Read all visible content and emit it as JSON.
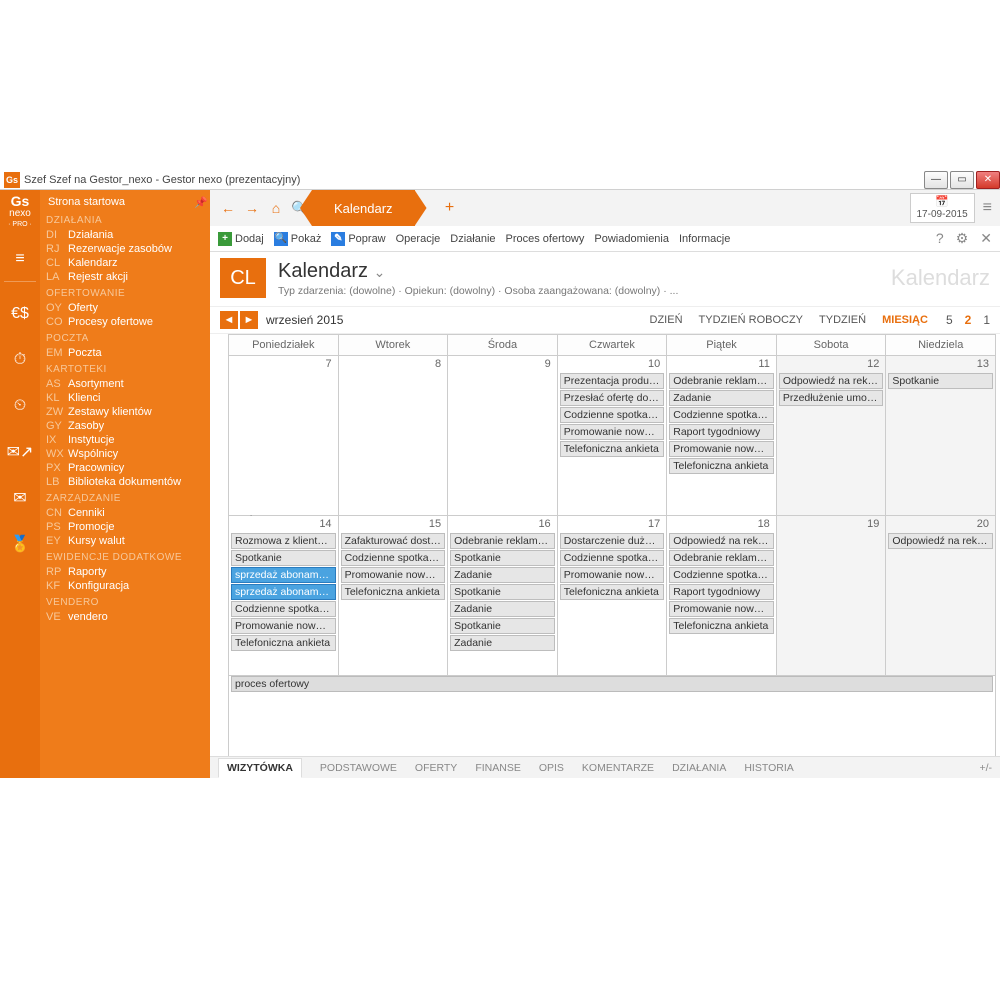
{
  "window": {
    "title": "Szef Szef na Gestor_nexo - Gestor nexo (prezentacyjny)",
    "app_icon_text": "Gs"
  },
  "logo": {
    "line1": "Gs",
    "line2": "nexo",
    "line3": "· PRO ·"
  },
  "date_widget": "17-09-2015",
  "sidenav": {
    "home": "Strona startowa",
    "groups": [
      {
        "title": "DZIAŁANIA",
        "items": [
          {
            "code": "DI",
            "label": "Działania"
          },
          {
            "code": "RJ",
            "label": "Rezerwacje zasobów"
          },
          {
            "code": "CL",
            "label": "Kalendarz"
          },
          {
            "code": "LA",
            "label": "Rejestr akcji"
          }
        ]
      },
      {
        "title": "OFERTOWANIE",
        "items": [
          {
            "code": "OY",
            "label": "Oferty"
          },
          {
            "code": "CO",
            "label": "Procesy ofertowe"
          }
        ]
      },
      {
        "title": "POCZTA",
        "items": [
          {
            "code": "EM",
            "label": "Poczta"
          }
        ]
      },
      {
        "title": "KARTOTEKI",
        "items": [
          {
            "code": "AS",
            "label": "Asortyment"
          },
          {
            "code": "KL",
            "label": "Klienci"
          },
          {
            "code": "ZW",
            "label": "Zestawy klientów"
          },
          {
            "code": "GY",
            "label": "Zasoby"
          },
          {
            "code": "IX",
            "label": "Instytucje"
          },
          {
            "code": "WX",
            "label": "Wspólnicy"
          },
          {
            "code": "PX",
            "label": "Pracownicy"
          },
          {
            "code": "LB",
            "label": "Biblioteka dokumentów"
          }
        ]
      },
      {
        "title": "ZARZĄDZANIE",
        "items": [
          {
            "code": "CN",
            "label": "Cenniki"
          },
          {
            "code": "PS",
            "label": "Promocje"
          },
          {
            "code": "EY",
            "label": "Kursy walut"
          }
        ]
      },
      {
        "title": "EWIDENCJE DODATKOWE",
        "items": [
          {
            "code": "RP",
            "label": "Raporty"
          },
          {
            "code": "KF",
            "label": "Konfiguracja"
          }
        ]
      },
      {
        "title": "VENDERO",
        "items": [
          {
            "code": "VE",
            "label": "vendero"
          }
        ]
      }
    ]
  },
  "tabs": {
    "active": "Kalendarz"
  },
  "toolbar": {
    "add": "Dodaj",
    "show": "Pokaż",
    "edit": "Popraw",
    "ops": "Operacje",
    "action": "Działanie",
    "offer": "Proces ofertowy",
    "notif": "Powiadomienia",
    "info": "Informacje"
  },
  "header": {
    "code": "CL",
    "title": "Kalendarz",
    "subtitle": "Typ zdarzenia: (dowolne) · Opiekun: (dowolny) · Osoba zaangażowana: (dowolny) · ...",
    "ghost": "Kalendarz"
  },
  "period": {
    "label": "wrzesień 2015",
    "vertical": "Wrzesień 2015",
    "modes": [
      "DZIEŃ",
      "TYDZIEŃ ROBOCZY",
      "TYDZIEŃ",
      "MIESIĄC"
    ],
    "mode_active": "MIESIĄC",
    "nums": [
      "5",
      "2",
      "1"
    ],
    "num_active": "2"
  },
  "calendar": {
    "day_headers": [
      "Poniedziałek",
      "Wtorek",
      "Środa",
      "Czwartek",
      "Piątek",
      "Sobota",
      "Niedziela"
    ],
    "weeks": [
      {
        "days": [
          {
            "num": 7,
            "events": []
          },
          {
            "num": 8,
            "events": []
          },
          {
            "num": 9,
            "events": []
          },
          {
            "num": 10,
            "events": [
              "Prezentacja produktó...",
              "Przesłać ofertę do fir...",
              "Codzienne spotkanie...",
              "Promowanie noweg...",
              "Telefoniczna ankieta"
            ]
          },
          {
            "num": 11,
            "events": [
              "Odebranie reklamacj...",
              "Zadanie",
              "Codzienne spotkanie...",
              "Raport tygodniowy",
              "Promowanie noweg...",
              "Telefoniczna ankieta"
            ]
          },
          {
            "num": 12,
            "weekend": true,
            "events": [
              "Odpowiedź na rekla...",
              "Przedłużenie umowy"
            ]
          },
          {
            "num": 13,
            "weekend": true,
            "events": [
              "Spotkanie"
            ]
          }
        ]
      },
      {
        "days": [
          {
            "num": 14,
            "events": [
              "Rozmowa z klientem...",
              "Spotkanie",
              {
                "t": "sprzedaż abonamentu",
                "c": "blue"
              },
              {
                "t": "sprzedaż abonamentu",
                "c": "blue"
              },
              "Codzienne spotkanie...",
              "Promowanie noweg...",
              "Telefoniczna ankieta"
            ]
          },
          {
            "num": 15,
            "events": [
              "Zafakturować dosta...",
              "Codzienne spotkanie...",
              "Promowanie noweg...",
              "Telefoniczna ankieta"
            ]
          },
          {
            "num": 16,
            "events": [
              "Odebranie reklamacj...",
              "Spotkanie",
              "Zadanie",
              "Spotkanie",
              "Zadanie",
              "Spotkanie",
              "Zadanie"
            ]
          },
          {
            "num": 17,
            "events": [
              "Dostarczenie dużej il...",
              "Codzienne spotkanie...",
              "Promowanie noweg...",
              "Telefoniczna ankieta"
            ]
          },
          {
            "num": 18,
            "events": [
              "Odpowiedź na rekla...",
              "Odebranie reklamacj...",
              "Codzienne spotkanie...",
              "Raport tygodniowy",
              "Promowanie noweg...",
              "Telefoniczna ankieta"
            ]
          },
          {
            "num": 19,
            "weekend": true,
            "events": []
          },
          {
            "num": 20,
            "weekend": true,
            "events": [
              "Odpowiedź na reklam..."
            ]
          }
        ],
        "span_event": "proces ofertowy",
        "extra_under_col": 2,
        "extra_under_label": "Spotkanie"
      }
    ]
  },
  "bottom_tabs": [
    "WIZYTÓWKA",
    "PODSTAWOWE",
    "OFERTY",
    "FINANSE",
    "OPIS",
    "KOMENTARZE",
    "DZIAŁANIA",
    "HISTORIA"
  ],
  "bottom_active": "WIZYTÓWKA",
  "bottom_pm": "+/-"
}
